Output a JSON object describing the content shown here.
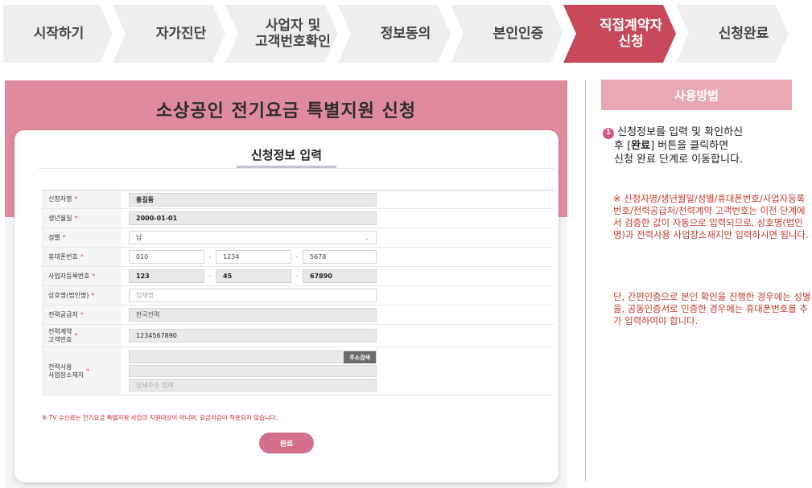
{
  "steps": [
    {
      "label": "시작하기"
    },
    {
      "label": "자가진단"
    },
    {
      "label": "사업자 및\n고객번호확인"
    },
    {
      "label": "정보동의"
    },
    {
      "label": "본인인증"
    },
    {
      "label": "직접계약자\n신청",
      "active": true
    },
    {
      "label": "신청완료"
    }
  ],
  "colors": {
    "active_step": "#c6485a",
    "inactive_step": "#eeeeee",
    "banner": "#e08aa0",
    "button": "#d4708e",
    "accent": "#d6577a"
  },
  "panel": {
    "title": "소상공인 전기요금 특별지원 신청",
    "card_title": "신청정보 입력"
  },
  "form": {
    "name": {
      "label": "신청자명",
      "value": "홍길동"
    },
    "birth": {
      "label": "생년월일",
      "value": "2000-01-01"
    },
    "gender": {
      "label": "성별",
      "value": "남"
    },
    "phone": {
      "label": "휴대폰번호",
      "p1": "010",
      "p2": "1234",
      "p3": "5678"
    },
    "bizno": {
      "label": "사업자등록번호",
      "p1": "123",
      "p2": "45",
      "p3": "67890"
    },
    "company": {
      "label": "상호명(법인명)",
      "placeholder": "업체명"
    },
    "supplier": {
      "label": "전력공급처",
      "value": "한국전력"
    },
    "custno": {
      "label": "전력계약\n고객번호",
      "value": "1234567890"
    },
    "address": {
      "label": "전력사용\n사업장소재지",
      "search_button": "주소검색",
      "detail_placeholder": "상세주소 입력"
    },
    "required_mark": "*",
    "dash": "-",
    "notice": "※ TV 수신료는 전기요금 특별지원 사업의 지원대상이 아니며, 요금차감이 적용되지 않습니다.",
    "submit": "완료"
  },
  "howto": {
    "title": "사용방법",
    "num": "1",
    "instruction_1": "신청정보를 입력 및 확인하신",
    "instruction_2a": "후 [",
    "instruction_2b": "완료",
    "instruction_2c": "] 버튼을 클릭하면",
    "instruction_3": "신청 완료 단계로 이동합니다.",
    "note_1": "※ 신청자명/생년월일/성별/휴대폰번호/사업자등록번호/전력공급처/전력계약 고객번호는 이전 단계에서 검증한 값이 자동으로 입력되므로, 상호명(법인명)과 전력사용 사업장소재지만 입력하시면 됩니다.",
    "note_2": "단, 간편인증으로 본인 확인을 진행한 경우에는 성별을, 공동인증서로 인증한 경우에는 휴대폰번호를 추가 입력하여야 합니다."
  }
}
